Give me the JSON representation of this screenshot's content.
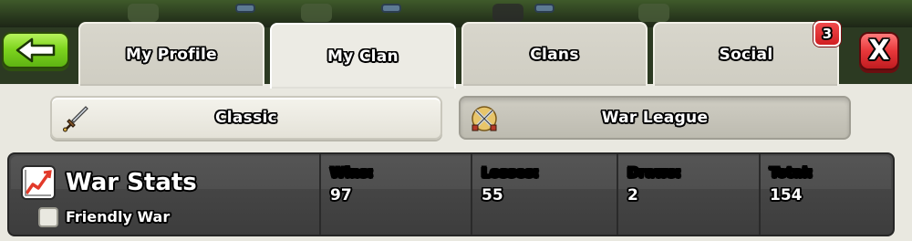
{
  "tabs": [
    {
      "label": "My Profile",
      "active": false
    },
    {
      "label": "My Clan",
      "active": true
    },
    {
      "label": "Clans",
      "active": false
    },
    {
      "label": "Social",
      "active": false
    }
  ],
  "notification_badge": "3",
  "close_label": "X",
  "subtabs": [
    {
      "label": "Classic",
      "icon": "sword-icon",
      "selected": true
    },
    {
      "label": "War League",
      "icon": "crossed-swords-icon",
      "selected": false
    }
  ],
  "war_stats": {
    "title": "War Stats",
    "friendly_war_label": "Friendly War",
    "friendly_war_checked": false,
    "stats": [
      {
        "label": "Wins:",
        "value": "97",
        "color": "#c6ec7a"
      },
      {
        "label": "Losses:",
        "value": "55",
        "color": "#ffb8b8"
      },
      {
        "label": "Draws:",
        "value": "2",
        "color": "#c9c9c9"
      },
      {
        "label": "Total:",
        "value": "154",
        "color": "#f4e37a"
      }
    ]
  },
  "colors": {
    "back_button": "#7fd51f",
    "close_button": "#e8373a",
    "badge": "#d11e22",
    "panel": "#e9e8e0",
    "stats_bar": "#444444"
  }
}
